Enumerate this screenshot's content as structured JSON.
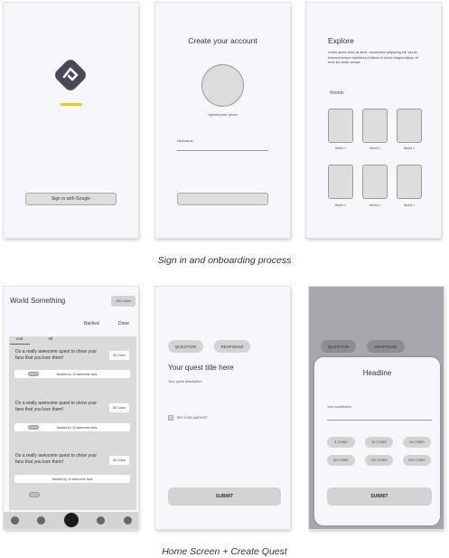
{
  "colors": {
    "logo_bg": "#4a4756",
    "accent_underline": "#f5c518",
    "screen_bg": "#f7f6fb",
    "button_gray": "#dedede",
    "overlay": "#a8a8ac"
  },
  "signin": {
    "google_button": "Sign in with Google",
    "logo_icon": "diamond-logo-icon"
  },
  "create_account": {
    "title": "Create your account",
    "upload_label": "Upload your photo",
    "nickname_label": "Nickname"
  },
  "explore": {
    "title": "Explore",
    "body": "Lorem ipsum dolor sit amet, consectetur adipiscing elit, sed do eiusmod tempor incididunt ut labore et dolore magna aliqua. Ut enim ad minim veniam",
    "worlds_label": "Worlds",
    "tiles": [
      "World 1",
      "World 1",
      "World 1",
      "World 1",
      "World 1",
      "World 1"
    ]
  },
  "caption_top": "Sign in and onboarding process",
  "home": {
    "title": "World Something",
    "coins_badge": "100 Coins",
    "filter_backed": "Backed",
    "filter_done": "Done",
    "tab_hot": "Hot",
    "tab_all": "All",
    "cards": [
      {
        "text": "Do a really awesome quest to show your fans that you love them!",
        "coins": "50 Coins",
        "backed": "Backed by 10 awesome fans"
      },
      {
        "text": "Do a really awesome quest to show your fans that you love them!",
        "coins": "50 Coins",
        "backed": "Backed by 10 awesome fans"
      },
      {
        "text": "Do a really awesome quest to show your fans that you love them!",
        "coins": "50 Coins",
        "backed": "Backed by 10 awesome fans"
      }
    ]
  },
  "create_quest": {
    "tab_question": "QUESTION",
    "tab_response": "RESPONSE",
    "title": "Your quest title here",
    "description": "Your quest description",
    "checkbox_label": "SET COIN AMOUNT",
    "submit": "SUBMIT"
  },
  "contribute": {
    "tab_question": "QUESTION",
    "tab_response": "RESPONSE",
    "headline": "Headline",
    "contribution_label": "Your contribution",
    "coin_options": [
      "5 COINS",
      "10 COINS",
      "20 COINS",
      "50 COINS",
      "100 COINS",
      "200 COINS"
    ],
    "submit": "SUBMIT"
  },
  "caption_bottom": "Home Screen + Create Quest"
}
